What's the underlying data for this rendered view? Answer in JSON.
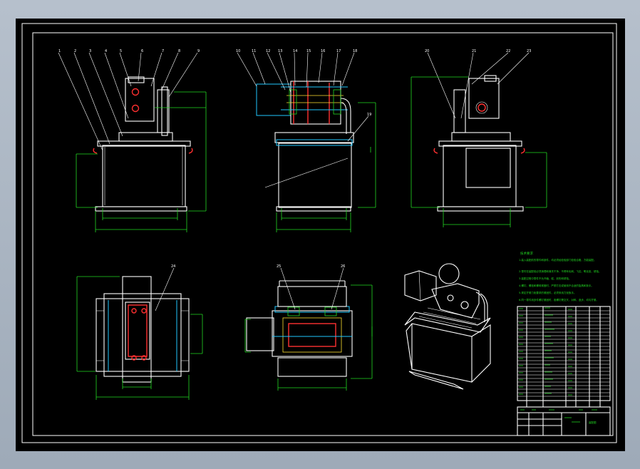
{
  "drawing": {
    "balloons_front": [
      "1",
      "2",
      "3",
      "4",
      "5",
      "6",
      "7",
      "8",
      "9"
    ],
    "balloons_side": [
      "10",
      "11",
      "12",
      "13",
      "14",
      "15",
      "16",
      "17",
      "18"
    ],
    "balloon_side_low": "19",
    "balloons_right": [
      "20",
      "21",
      "22",
      "23"
    ],
    "balloons_bottom": [
      "24",
      "25",
      "26"
    ],
    "notes_title": "技术要求",
    "notes_lines": [
      "1.装入装配前的零件和部件，均必须经检验部门检验合格，方能装配。",
      "2.零件在装配前必须清理和清洗干净，不得有毛刺、飞边、氧化皮、锈蚀。",
      "3.装配过程中零件不允许磕、碰、划伤和锈蚀。",
      "4.螺钉、螺栓和螺母紧固时，严禁打击或使用不合适的旋具和扳手。",
      "5.规定拧紧力矩要求的紧固件，必须采用力矩扳手。",
      "6.同一零件用多件螺钉紧固时，各螺钉需交叉、对称、逐步、均匀拧紧。"
    ],
    "title_block_name": "装配图"
  },
  "colors": {
    "background": "#000000",
    "outline": "#ffffff",
    "dimension": "#22d822",
    "section": "#ff3030",
    "center": "#20c8ff"
  }
}
